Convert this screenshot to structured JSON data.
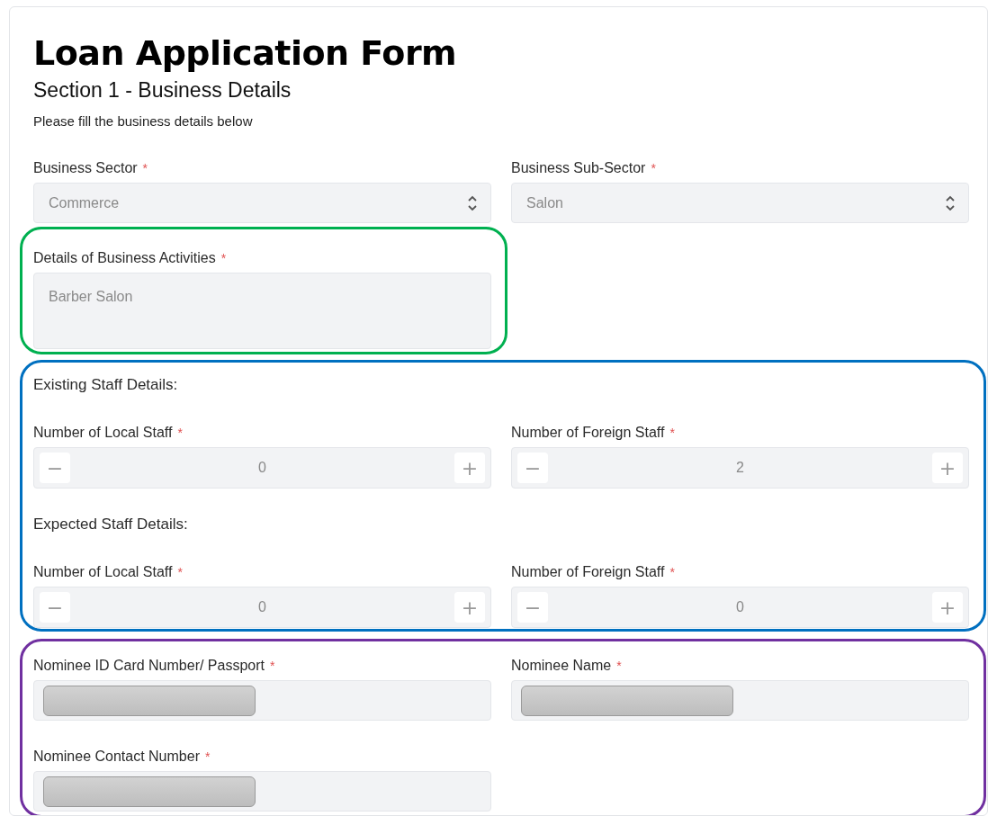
{
  "title": "Loan Application Form",
  "section_title": "Section 1 - Business Details",
  "instruction": "Please fill the business details below",
  "sections": [
    {
      "items": [
        {
          "kind": "row",
          "fields": [
            {
              "kind": "select",
              "label": "Business Sector",
              "required_mark": "*",
              "value": "Commerce"
            },
            {
              "kind": "select",
              "label": "Business Sub-Sector",
              "required_mark": "*",
              "value": "Salon"
            }
          ]
        }
      ]
    },
    {
      "color": "#00b050",
      "items": [
        {
          "kind": "row",
          "fields": [
            {
              "kind": "textarea",
              "label": "Details of Business Activities",
              "required_mark": "*",
              "value": "Barber Salon"
            }
          ]
        }
      ]
    },
    {
      "color": "#0070c0",
      "items": [
        {
          "kind": "heading",
          "text": "Existing Staff Details:"
        },
        {
          "kind": "row",
          "fields": [
            {
              "kind": "stepper",
              "label": "Number of Local Staff",
              "required_mark": "*",
              "value": "0",
              "decrement": "−",
              "increment": "+"
            },
            {
              "kind": "stepper",
              "label": "Number of Foreign Staff",
              "required_mark": "*",
              "value": "2",
              "decrement": "−",
              "increment": "+"
            }
          ]
        },
        {
          "kind": "heading",
          "text": "Expected Staff Details:"
        },
        {
          "kind": "row",
          "fields": [
            {
              "kind": "stepper",
              "label": "Number of Local Staff",
              "required_mark": "*",
              "value": "0",
              "decrement": "−",
              "increment": "+"
            },
            {
              "kind": "stepper",
              "label": "Number of Foreign Staff",
              "required_mark": "*",
              "value": "0",
              "decrement": "−",
              "increment": "+"
            }
          ]
        }
      ]
    },
    {
      "color": "#7030a0",
      "items": [
        {
          "kind": "row",
          "fields": [
            {
              "kind": "redacted",
              "label": "Nominee ID Card Number/ Passport",
              "required_mark": "*"
            },
            {
              "kind": "redacted",
              "label": "Nominee Name",
              "required_mark": "*"
            }
          ]
        },
        {
          "kind": "row",
          "fields": [
            {
              "kind": "redacted",
              "label": "Nominee Contact Number",
              "required_mark": "*"
            }
          ]
        }
      ]
    }
  ]
}
